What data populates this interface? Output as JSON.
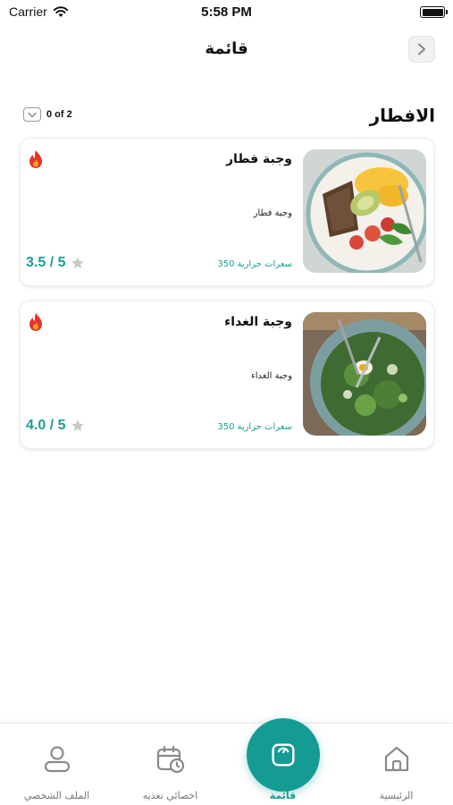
{
  "status_bar": {
    "carrier": "Carrier",
    "time": "5:58 PM"
  },
  "header": {
    "title": "قائمة"
  },
  "section": {
    "title": "الافطار",
    "counter": "0 of 2"
  },
  "meals": [
    {
      "name": "وجبة فطار",
      "description": "وجبة فطار",
      "calories_value": "350",
      "calories_unit": "سعرات حرارية",
      "rating": "3.5 / 5"
    },
    {
      "name": "وجبة الغداء",
      "description": "وجبة الغداء",
      "calories_value": "350",
      "calories_unit": "سعرات حرارية",
      "rating": "4.0 / 5"
    }
  ],
  "tabs": {
    "home": "الرئيسية",
    "menu": "قائمة",
    "nutritionist": "اخصائي تغذيه",
    "profile": "الملف الشخصي"
  },
  "colors": {
    "accent": "#149c94",
    "rating": "#1a9f93",
    "fire": "#e8322c"
  },
  "icons": {
    "back": "chevron-right-icon",
    "fire": "fire-icon",
    "star": "star-icon",
    "home": "home-icon",
    "menu": "scale-icon",
    "nutritionist": "calendar-clock-icon",
    "profile": "person-icon"
  }
}
